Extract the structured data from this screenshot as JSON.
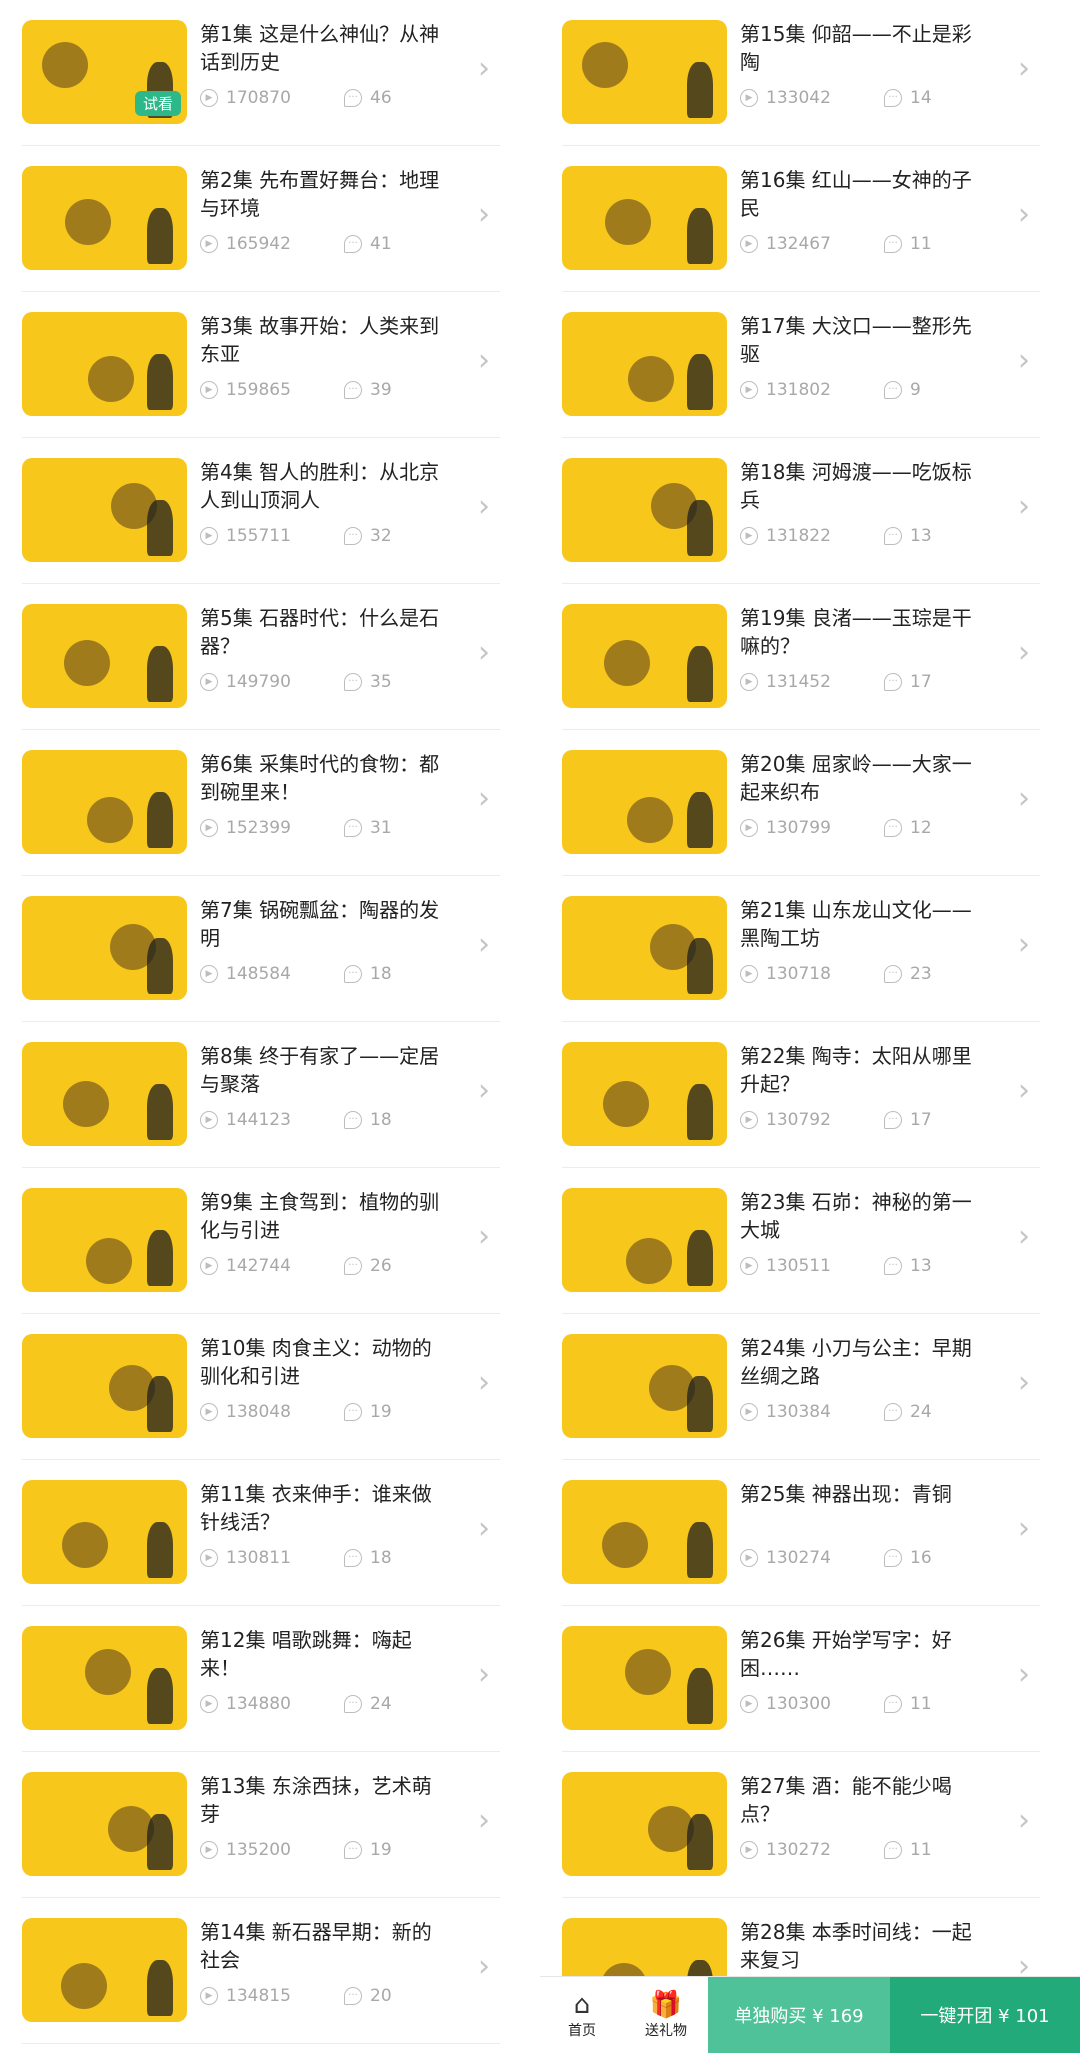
{
  "trial_label": "试看",
  "left": [
    {
      "title": "第1集 这是什么神仙？从神话到历史",
      "plays": "170870",
      "comments": "46",
      "trial": true
    },
    {
      "title": "第2集 先布置好舞台：地理与环境",
      "plays": "165942",
      "comments": "41"
    },
    {
      "title": "第3集 故事开始：人类来到东亚",
      "plays": "159865",
      "comments": "39"
    },
    {
      "title": "第4集 智人的胜利：从北京人到山顶洞人",
      "plays": "155711",
      "comments": "32"
    },
    {
      "title": "第5集 石器时代：什么是石器？",
      "plays": "149790",
      "comments": "35"
    },
    {
      "title": "第6集 采集时代的食物：都到碗里来！",
      "plays": "152399",
      "comments": "31"
    },
    {
      "title": "第7集 锅碗瓢盆：陶器的发明",
      "plays": "148584",
      "comments": "18"
    },
    {
      "title": "第8集 终于有家了——定居与聚落",
      "plays": "144123",
      "comments": "18"
    },
    {
      "title": "第9集 主食驾到：植物的驯化与引进",
      "plays": "142744",
      "comments": "26"
    },
    {
      "title": "第10集 肉食主义：动物的驯化和引进",
      "plays": "138048",
      "comments": "19"
    },
    {
      "title": "第11集 衣来伸手：谁来做针线活？",
      "plays": "130811",
      "comments": "18"
    },
    {
      "title": "第12集 唱歌跳舞：嗨起来！",
      "plays": "134880",
      "comments": "24"
    },
    {
      "title": "第13集 东涂西抹，艺术萌芽",
      "plays": "135200",
      "comments": "19"
    },
    {
      "title": "第14集 新石器早期：新的社会",
      "plays": "134815",
      "comments": "20"
    }
  ],
  "right": [
    {
      "title": "第15集 仰韶——不止是彩陶",
      "plays": "133042",
      "comments": "14"
    },
    {
      "title": "第16集 红山——女神的子民",
      "plays": "132467",
      "comments": "11"
    },
    {
      "title": "第17集 大汶口——整形先驱",
      "plays": "131802",
      "comments": "9"
    },
    {
      "title": "第18集 河姆渡——吃饭标兵",
      "plays": "131822",
      "comments": "13"
    },
    {
      "title": "第19集 良渚——玉琮是干嘛的？",
      "plays": "131452",
      "comments": "17"
    },
    {
      "title": "第20集 屈家岭——大家一起来织布",
      "plays": "130799",
      "comments": "12"
    },
    {
      "title": "第21集 山东龙山文化——黑陶工坊",
      "plays": "130718",
      "comments": "23"
    },
    {
      "title": "第22集 陶寺：太阳从哪里升起？",
      "plays": "130792",
      "comments": "17"
    },
    {
      "title": "第23集 石峁：神秘的第一大城",
      "plays": "130511",
      "comments": "13"
    },
    {
      "title": "第24集 小刀与公主：早期丝绸之路",
      "plays": "130384",
      "comments": "24"
    },
    {
      "title": "第25集 神器出现：青铜",
      "plays": "130274",
      "comments": "16"
    },
    {
      "title": "第26集 开始学写字：好困……",
      "plays": "130300",
      "comments": "11"
    },
    {
      "title": "第27集 酒：能不能少喝点？",
      "plays": "130272",
      "comments": "11"
    },
    {
      "title": "第28集 本季时间线：一起来复习",
      "plays": "",
      "comments": ""
    }
  ],
  "bottom_bar": {
    "home_label": "首页",
    "gift_label": "送礼物",
    "buy_single_label": "单独购买 ¥ 169",
    "buy_group_label": "一键开团 ¥ 101"
  },
  "icons": {
    "play": "play-icon",
    "comment": "comment-icon",
    "chevron": "chevron-right-icon",
    "home": "home-icon",
    "gift": "gift-icon"
  },
  "colors": {
    "thumb_bg": "#f7c81b",
    "primary": "#22aa7b",
    "secondary": "#4fc29a",
    "badge": "#2db88a"
  }
}
